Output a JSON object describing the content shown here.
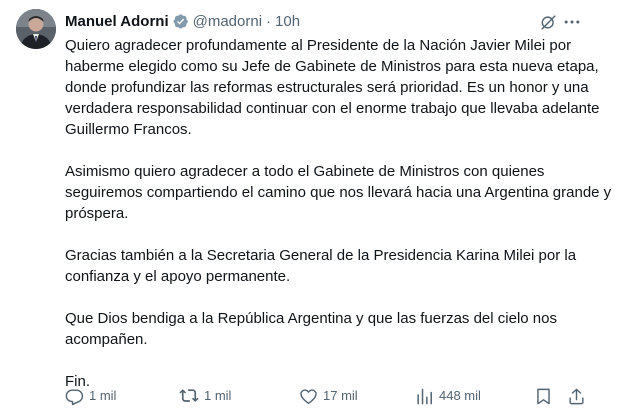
{
  "author": {
    "name": "Manuel Adorni",
    "handle": "@madorni",
    "separator": "·",
    "time": "10h"
  },
  "body": {
    "paragraphs": [
      "Quiero agradecer profundamente al Presidente de la Nación Javier Milei por haberme elegido como su Jefe de Gabinete de Ministros para esta nueva etapa, donde profundizar las reformas estructurales será prioridad. Es un honor y una verdadera responsabilidad continuar con el enorme trabajo que llevaba adelante Guillermo Francos.",
      "Asimismo quiero agradecer a todo el Gabinete de Ministros con quienes seguiremos compartiendo el camino que nos llevará hacia una Argentina grande y próspera.",
      "Gracias también a la Secretaria General de la Presidencia Karina Milei por la confianza y el apoyo permanente.",
      "Que Dios bendiga a la República Argentina y que las fuerzas del cielo nos acompañen.",
      "Fin."
    ]
  },
  "actions": {
    "replies": "1 mil",
    "reposts": "1 mil",
    "likes": "17 mil",
    "views": "448 mil"
  },
  "icons": {
    "verified": "verified-badge-icon",
    "grok": "grok-icon",
    "more": "more-icon",
    "reply": "reply-icon",
    "repost": "repost-icon",
    "like": "heart-icon",
    "views": "views-icon",
    "bookmark": "bookmark-icon",
    "share": "share-icon"
  },
  "colors": {
    "text": "#0f1419",
    "secondary": "#536471",
    "verified": "#829aab"
  }
}
